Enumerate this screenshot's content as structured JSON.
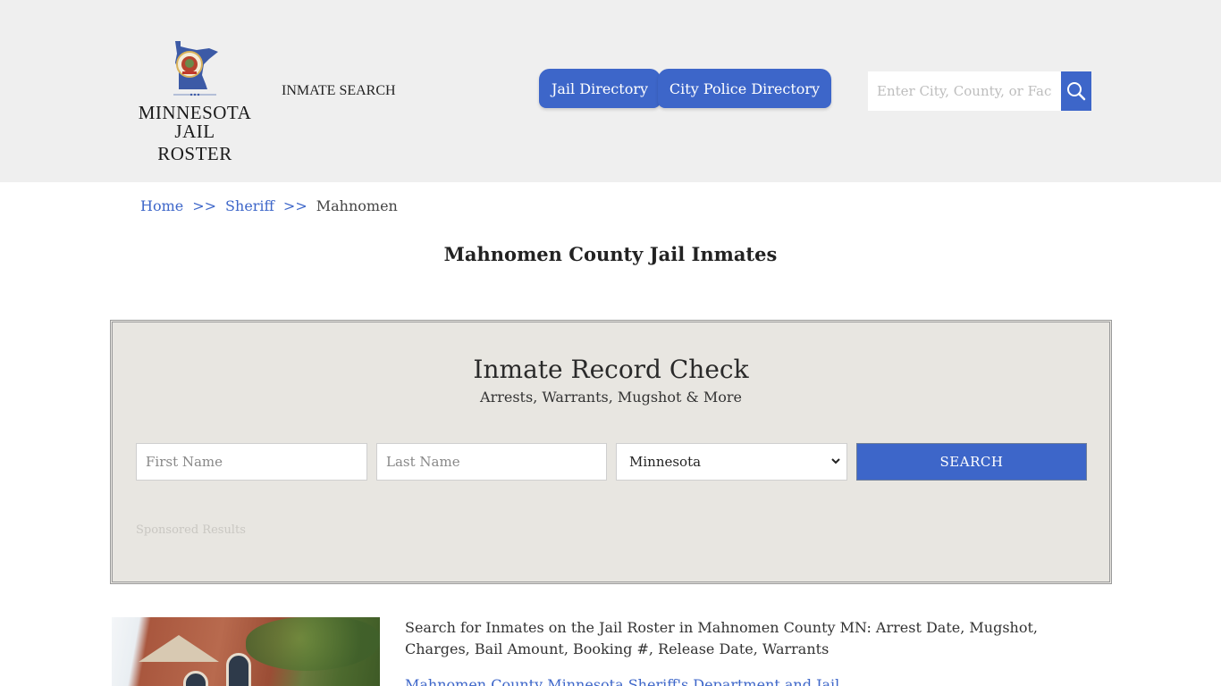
{
  "header": {
    "logo": {
      "line1": "MINNESOTA",
      "line2": "JAIL ROSTER",
      "icon": "minnesota-state-seal-icon"
    },
    "nav_inmate_search": "INMATE SEARCH",
    "tabs": [
      {
        "label": "Jail Directory"
      },
      {
        "label": "City Police Directory"
      }
    ],
    "search": {
      "placeholder": "Enter City, County, or Facility",
      "value": "",
      "icon": "search-icon"
    }
  },
  "breadcrumb": {
    "items": [
      {
        "label": "Home"
      },
      {
        "label": "Sheriff"
      },
      {
        "label": "Mahnomen"
      }
    ],
    "separator": ">>"
  },
  "page_title": "Mahnomen County Jail Inmates",
  "record_check": {
    "title": "Inmate Record Check",
    "subtitle": "Arrests, Warrants, Mugshot & More",
    "first_name_placeholder": "First Name",
    "last_name_placeholder": "Last Name",
    "state_selected": "Minnesota",
    "search_label": "SEARCH",
    "sponsored": "Sponsored Results"
  },
  "intro": {
    "text": "Search for Inmates on the Jail Roster in Mahnomen County MN: Arrest Date, Mugshot, Charges, Bail Amount, Booking #, Release Date, Warrants",
    "link": "Mahnomen County Minnesota Sheriff's Department and Jail"
  },
  "colors": {
    "accent": "#3d66c9",
    "header_bg": "#efefef",
    "box_bg": "#e8e6e1"
  }
}
